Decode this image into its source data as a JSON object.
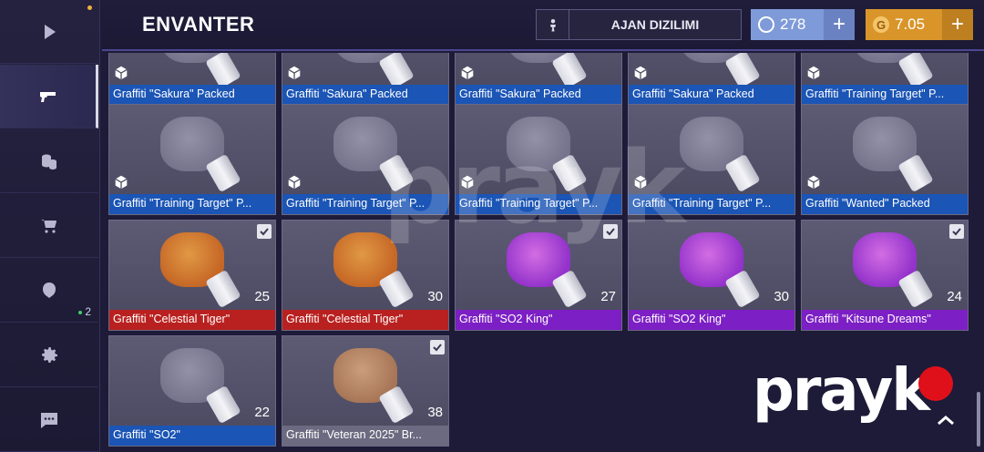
{
  "header": {
    "title": "ENVANTER",
    "agent_button": "AJAN DIZILIMI",
    "credits": {
      "value": "278",
      "plus": "+",
      "color": "#7e9ad8"
    },
    "gold": {
      "value": "7.05",
      "plus": "+",
      "color": "#d9952a"
    }
  },
  "sidebar": {
    "items": [
      {
        "icon": "play-icon"
      },
      {
        "icon": "pistol-icon",
        "active": true
      },
      {
        "icon": "coins-icon"
      },
      {
        "icon": "cart-icon"
      },
      {
        "icon": "clan-icon",
        "badge": "2"
      },
      {
        "icon": "gear-icon"
      },
      {
        "icon": "chat-icon"
      }
    ]
  },
  "inventory": {
    "rows": [
      [
        {
          "label": "Graffiti \"Sakura\" Packed",
          "rarity": "blue"
        },
        {
          "label": "Graffiti \"Sakura\" Packed",
          "rarity": "blue"
        },
        {
          "label": "Graffiti \"Sakura\" Packed",
          "rarity": "blue"
        },
        {
          "label": "Graffiti \"Sakura\" Packed",
          "rarity": "blue"
        },
        {
          "label": "Graffiti \"Training Target\" P...",
          "rarity": "blue"
        }
      ],
      [
        {
          "label": "Graffiti \"Training Target\" P...",
          "rarity": "blue"
        },
        {
          "label": "Graffiti \"Training Target\" P...",
          "rarity": "blue"
        },
        {
          "label": "Graffiti \"Training Target\" P...",
          "rarity": "blue"
        },
        {
          "label": "Graffiti \"Training Target\" P...",
          "rarity": "blue"
        },
        {
          "label": "Graffiti \"Wanted\" Packed",
          "rarity": "blue"
        }
      ],
      [
        {
          "label": "Graffiti \"Celestial Tiger\"",
          "rarity": "red",
          "count": "25",
          "checked": true
        },
        {
          "label": "Graffiti \"Celestial Tiger\"",
          "rarity": "red",
          "count": "30",
          "checked": false
        },
        {
          "label": "Graffiti \"SO2 King\"",
          "rarity": "purple",
          "count": "27",
          "checked": true
        },
        {
          "label": "Graffiti \"SO2 King\"",
          "rarity": "purple",
          "count": "30",
          "checked": false
        },
        {
          "label": "Graffiti \"Kitsune Dreams\"",
          "rarity": "purple",
          "count": "24",
          "checked": true
        }
      ],
      [
        {
          "label": "Graffiti \"SO2\"",
          "rarity": "blue",
          "count": "22",
          "checked": false
        },
        {
          "label": "Graffiti \"Veteran 2025\" Br...",
          "rarity": "grey",
          "count": "38",
          "checked": true
        }
      ]
    ]
  },
  "watermark": {
    "text": "prayk"
  },
  "colors": {
    "blue": "#1b55b5",
    "red": "#b8211f",
    "purple": "#7c1fc4",
    "grey": "#6b6a80"
  }
}
